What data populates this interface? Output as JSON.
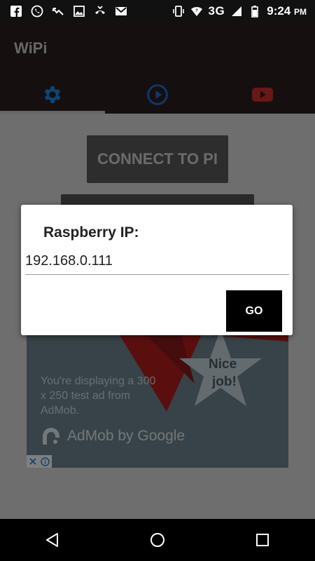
{
  "status_bar": {
    "network": "3G",
    "time": "9:24",
    "ampm": "PM"
  },
  "app": {
    "title": "WiPi",
    "tabs": [
      {
        "icon": "gear-icon",
        "active": true,
        "color": "#1e88e5"
      },
      {
        "icon": "play-circle-icon",
        "active": false,
        "color": "#1e6fd9"
      },
      {
        "icon": "youtube-icon",
        "active": false,
        "color": "#d32f2f"
      }
    ]
  },
  "main": {
    "connect_label": "CONNECT TO PI"
  },
  "ad": {
    "text": "You're displaying a 300 x 250 test ad from AdMob.",
    "star_text_1": "Nice",
    "star_text_2": "job!",
    "brand": "AdMob by Google"
  },
  "dialog": {
    "title": "Raspberry IP:",
    "ip_value": "192.168.0.111",
    "go_label": "GO"
  },
  "colors": {
    "app_bar": "#2a1f1f",
    "accent_blue": "#1e88e5",
    "youtube_red": "#d32f2f"
  }
}
